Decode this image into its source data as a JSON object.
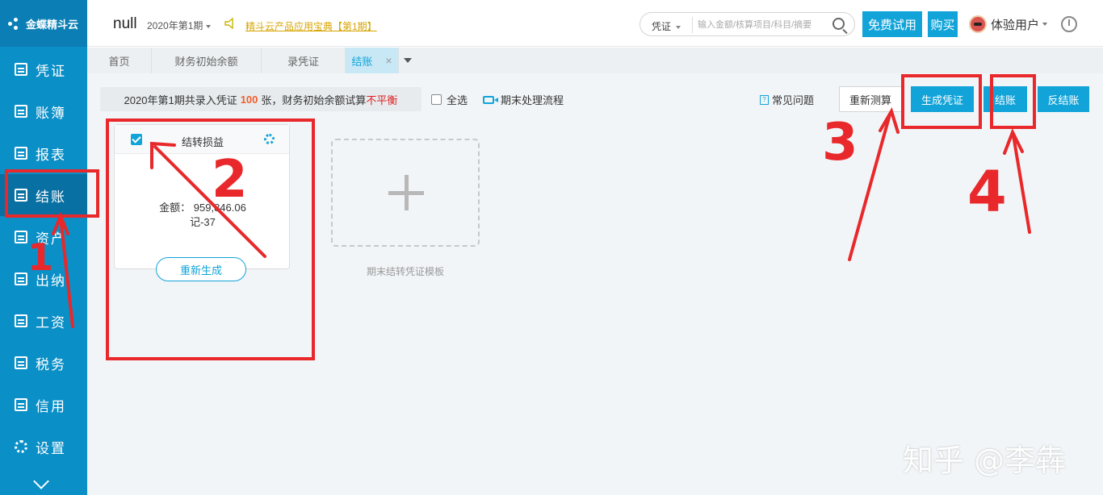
{
  "sidebar": {
    "logo": "金蝶精斗云",
    "items": [
      {
        "label": "凭证"
      },
      {
        "label": "账簿"
      },
      {
        "label": "报表"
      },
      {
        "label": "结账"
      },
      {
        "label": "资产"
      },
      {
        "label": "出纳"
      },
      {
        "label": "工资"
      },
      {
        "label": "税务"
      },
      {
        "label": "信用"
      },
      {
        "label": "设置"
      }
    ]
  },
  "header": {
    "company": "null",
    "period": "2020年第1期",
    "notice": "精斗云产品应用宝典【第1期】",
    "search": {
      "scope": "凭证",
      "placeholder": "输入金额/核算项目/科目/摘要"
    },
    "trial_btn": "免费试用",
    "buy_btn": "购买",
    "user": "体验用户"
  },
  "tabs": [
    {
      "label": "首页"
    },
    {
      "label": "财务初始余额"
    },
    {
      "label": "录凭证"
    },
    {
      "label": "结账",
      "close": "×"
    }
  ],
  "toolbar": {
    "summary_prefix": "2020年第1期共录入凭证",
    "summary_count": "100",
    "summary_mid": "张，财务初始余额试算",
    "summary_status": "不平衡",
    "select_all": "全选",
    "flow": "期末处理流程",
    "faq": "常见问题",
    "faq_icon": "?",
    "recalc": "重新测算",
    "gen_voucher": "生成凭证",
    "close_books": "结账",
    "reopen": "反结账"
  },
  "card": {
    "title": "结转损益",
    "amount": "金额：  959,846.06",
    "voucher": "记-37",
    "regen": "重新生成"
  },
  "template": {
    "label": "期末结转凭证模板"
  },
  "annotations": {
    "n1": "1",
    "n2": "2",
    "n3": "3",
    "n4": "4"
  },
  "watermark": "知乎 @李犇",
  "colors": {
    "sidebar": "#0a8fc7",
    "accent": "#12a4d9",
    "annotation": "#e8282a"
  }
}
